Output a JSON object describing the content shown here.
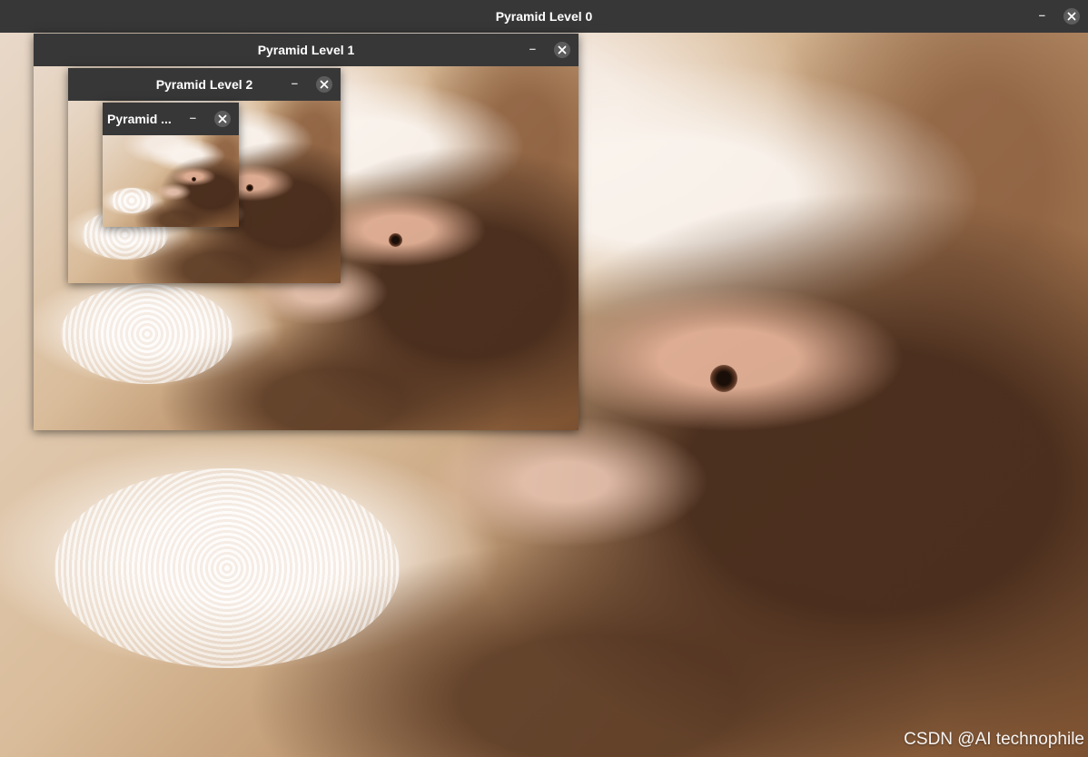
{
  "windows": [
    {
      "title": "Pyramid Level 0",
      "min_symbol": "–",
      "close_icon": "close-icon"
    },
    {
      "title": "Pyramid Level 1",
      "min_symbol": "–",
      "close_icon": "close-icon"
    },
    {
      "title": "Pyramid Level 2",
      "min_symbol": "–",
      "close_icon": "close-icon"
    },
    {
      "title": "Pyramid ...",
      "min_symbol": "–",
      "close_icon": "close-icon"
    }
  ],
  "watermark": "CSDN @AI technophile",
  "colors": {
    "titlebar": "#373737",
    "close_button": "#5c5c5c",
    "title_text": "#ffffff"
  }
}
